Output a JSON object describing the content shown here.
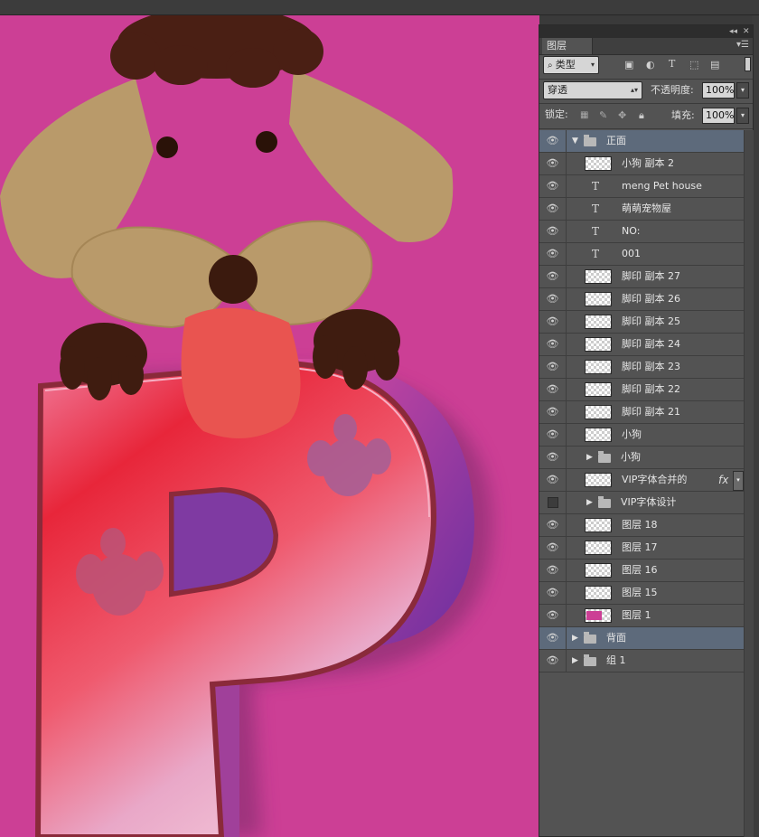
{
  "window": {
    "collapse_icon": "double-chevron-left-icon",
    "close_icon": "close-icon",
    "menu_icon": "panel-menu-icon"
  },
  "panel": {
    "tab": "图层",
    "filter": {
      "label": "类型",
      "icons": [
        "image-filter-icon",
        "adjustment-filter-icon",
        "type-filter-icon",
        "shape-filter-icon",
        "smart-object-filter-icon"
      ]
    },
    "blend_mode": "穿透",
    "opacity_label": "不透明度:",
    "opacity_value": "100%",
    "lock_label": "锁定:",
    "lock_icons": [
      "lock-transparent-icon",
      "lock-brush-icon",
      "lock-move-icon",
      "lock-all-icon"
    ],
    "fill_label": "填充:",
    "fill_value": "100%"
  },
  "layers": [
    {
      "name": "正面",
      "kind": "group",
      "expanded": true,
      "depth": 0,
      "visible": true,
      "selected": true
    },
    {
      "name": "小狗 副本 2",
      "kind": "pixel",
      "depth": 1,
      "visible": true
    },
    {
      "name": "meng Pet house",
      "kind": "text",
      "depth": 1,
      "visible": true
    },
    {
      "name": "萌萌宠物屋",
      "kind": "text",
      "depth": 1,
      "visible": true
    },
    {
      "name": "NO:",
      "kind": "text",
      "depth": 1,
      "visible": true
    },
    {
      "name": "001",
      "kind": "text",
      "depth": 1,
      "visible": true
    },
    {
      "name": "脚印 副本 27",
      "kind": "pixel",
      "depth": 1,
      "visible": true
    },
    {
      "name": "脚印 副本 26",
      "kind": "pixel",
      "depth": 1,
      "visible": true
    },
    {
      "name": "脚印 副本 25",
      "kind": "pixel",
      "depth": 1,
      "visible": true
    },
    {
      "name": "脚印 副本 24",
      "kind": "pixel",
      "depth": 1,
      "visible": true
    },
    {
      "name": "脚印 副本 23",
      "kind": "pixel",
      "depth": 1,
      "visible": true
    },
    {
      "name": "脚印 副本 22",
      "kind": "pixel",
      "depth": 1,
      "visible": true
    },
    {
      "name": "脚印 副本 21",
      "kind": "pixel",
      "depth": 1,
      "visible": true
    },
    {
      "name": "小狗",
      "kind": "pixel",
      "depth": 1,
      "visible": true
    },
    {
      "name": "小狗",
      "kind": "group",
      "expanded": false,
      "depth": 1,
      "visible": true
    },
    {
      "name": "VIP字体合并的",
      "kind": "pixel",
      "depth": 1,
      "visible": true,
      "fx": "fx"
    },
    {
      "name": "VIP字体设计",
      "kind": "group",
      "expanded": false,
      "depth": 1,
      "visible": false
    },
    {
      "name": "图层 18",
      "kind": "pixel",
      "depth": 1,
      "visible": true
    },
    {
      "name": "图层 17",
      "kind": "pixel",
      "depth": 1,
      "visible": true
    },
    {
      "name": "图层 16",
      "kind": "pixel",
      "depth": 1,
      "visible": true
    },
    {
      "name": "图层 15",
      "kind": "pixel",
      "depth": 1,
      "visible": true
    },
    {
      "name": "图层 1",
      "kind": "pixel",
      "depth": 1,
      "visible": true,
      "thumb": "pink"
    },
    {
      "name": "背面",
      "kind": "group",
      "expanded": false,
      "depth": 0,
      "visible": true,
      "selected": true
    },
    {
      "name": "组 1",
      "kind": "group",
      "expanded": false,
      "depth": 0,
      "visible": true
    }
  ],
  "colors": {
    "canvas_background": "#cc3f95",
    "dog_ear": "#b99a6a",
    "dog_nose": "#3b1a0e",
    "dog_tongue": "#e95450",
    "letter_red": "#e8263a",
    "letter_side": "#7a3aa0",
    "selected_row": "#5d6a7b"
  }
}
